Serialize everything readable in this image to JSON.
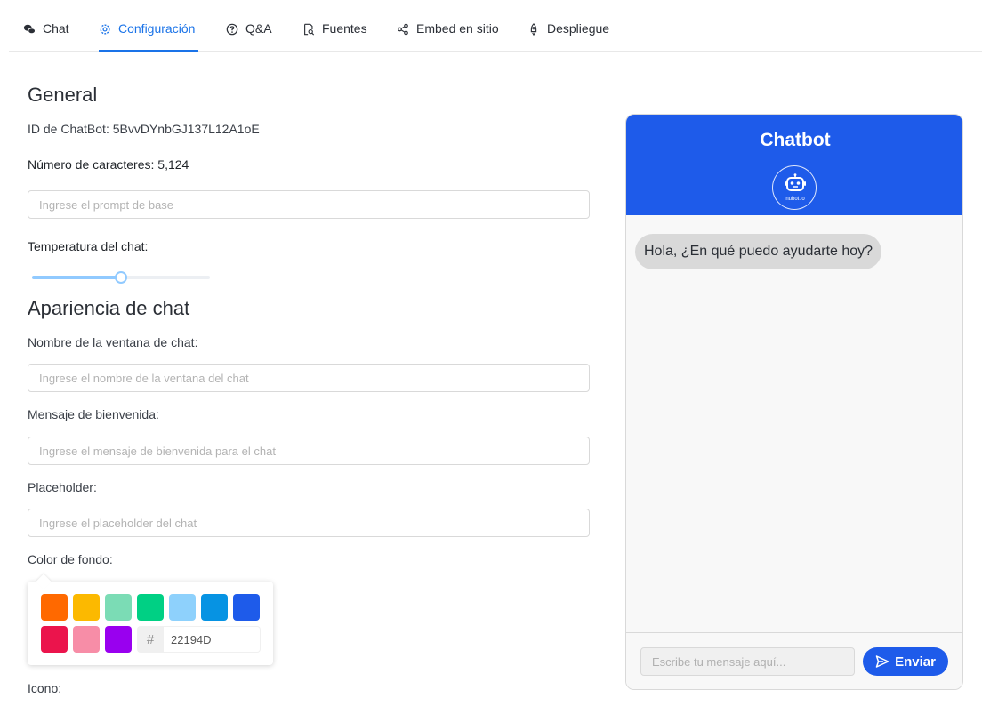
{
  "tabs": [
    {
      "label": "Chat",
      "icon": "chat-bubbles-icon"
    },
    {
      "label": "Configuración",
      "icon": "gear-icon",
      "active": true
    },
    {
      "label": "Q&A",
      "icon": "question-circle-icon"
    },
    {
      "label": "Fuentes",
      "icon": "document-search-icon"
    },
    {
      "label": "Embed en sitio",
      "icon": "share-icon"
    },
    {
      "label": "Despliegue",
      "icon": "rocket-icon"
    }
  ],
  "general": {
    "heading": "General",
    "chatbot_id": "ID de ChatBot: 5BvvDYnbGJ137L12A1oE",
    "char_count": "Número de caracteres: 5,124",
    "prompt_placeholder": "Ingrese el prompt de base",
    "temperature_label": "Temperatura del chat:",
    "temperature_value": 0.5
  },
  "appearance": {
    "heading": "Apariencia de chat",
    "window_name_label": "Nombre de la ventana de chat:",
    "window_name_placeholder": "Ingrese el nombre de la ventana del chat",
    "welcome_label": "Mensaje de bienvenida:",
    "welcome_placeholder": "Ingrese el mensaje de bienvenida para el chat",
    "placeholder_label": "Placeholder:",
    "placeholder_placeholder": "Ingrese el placeholder del chat",
    "bg_color_label": "Color de fondo:",
    "icon_label": "Icono:"
  },
  "color_picker": {
    "swatches": [
      "#ff6900",
      "#fcb900",
      "#7bdcb5",
      "#00d084",
      "#8ed1fc",
      "#0693e3",
      "#1e5bea",
      "#eb144c",
      "#f78da7",
      "#9900ef"
    ],
    "hash_symbol": "#",
    "hex_value": "22194D"
  },
  "preview": {
    "title": "Chatbot",
    "avatar_label": "nubot.io",
    "welcome_message": "Hola, ¿En qué puedo ayudarte hoy?",
    "input_placeholder": "Escribe tu mensaje aquí...",
    "send_label": "Enviar",
    "accent_color": "#1e5bea"
  }
}
